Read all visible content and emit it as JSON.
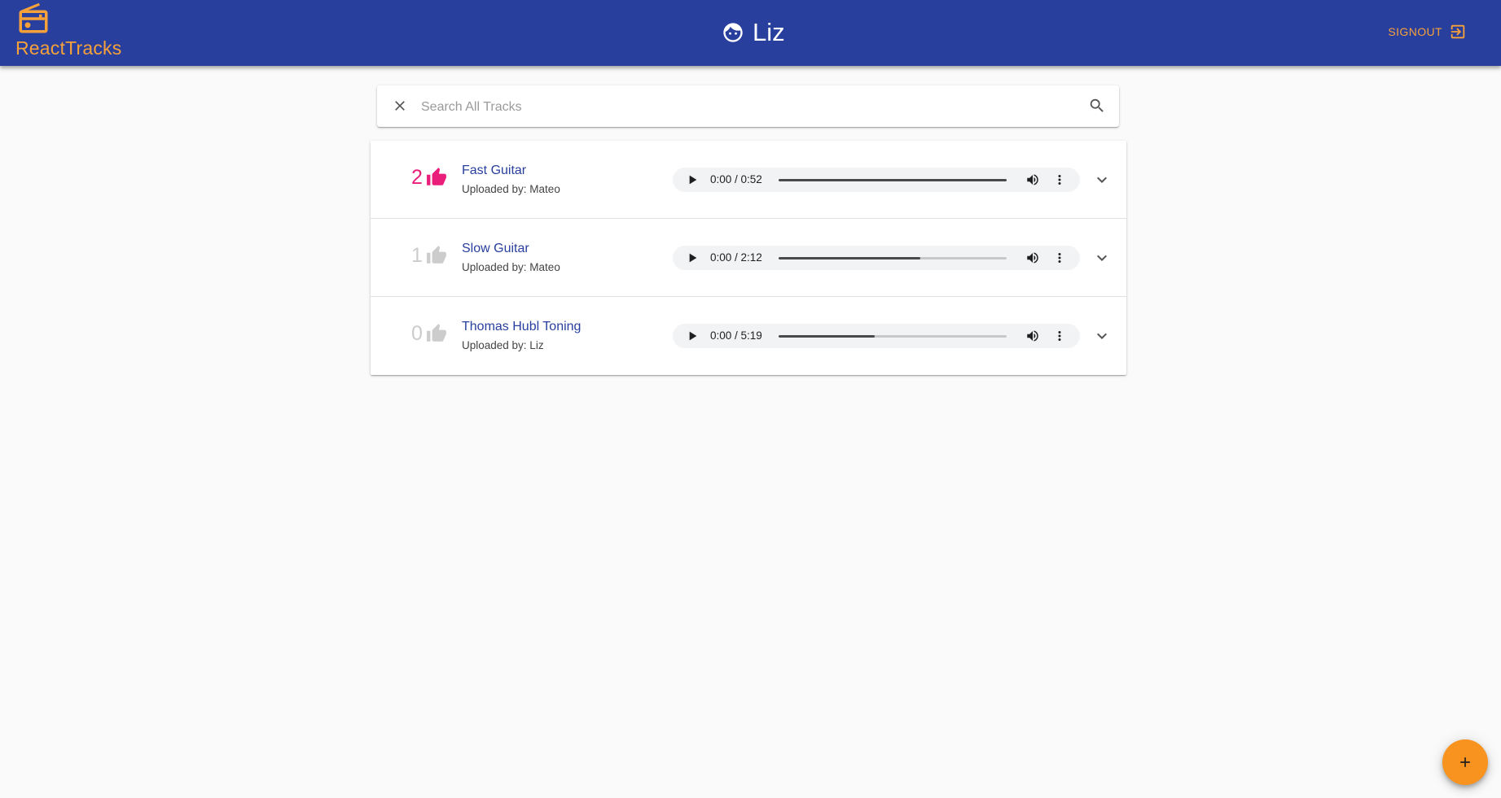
{
  "app": {
    "brand_title": "ReactTracks",
    "user_name": "Liz",
    "signout_label": "SIGNOUT",
    "icons": {
      "brand": "radio-icon",
      "user": "face-icon",
      "signout": "exit-to-app-icon"
    }
  },
  "colors": {
    "primary": "#283f9d",
    "accent": "#f7a13a",
    "liked": "#e91e7a",
    "not_liked": "#cccccc"
  },
  "search": {
    "placeholder": "Search All Tracks",
    "value": ""
  },
  "tracks": [
    {
      "likes": "2",
      "liked": true,
      "title": "Fast Guitar",
      "uploader": "Uploaded by: Mateo",
      "time": "0:00 / 0:52",
      "buffered": 1.0
    },
    {
      "likes": "1",
      "liked": false,
      "title": "Slow Guitar",
      "uploader": "Uploaded by: Mateo",
      "time": "0:00 / 2:12",
      "buffered": 0.62
    },
    {
      "likes": "0",
      "liked": false,
      "title": "Thomas Hubl Toning",
      "uploader": "Uploaded by: Liz",
      "time": "0:00 / 5:19",
      "buffered": 0.42
    }
  ],
  "fab": {
    "icon": "add-icon"
  }
}
